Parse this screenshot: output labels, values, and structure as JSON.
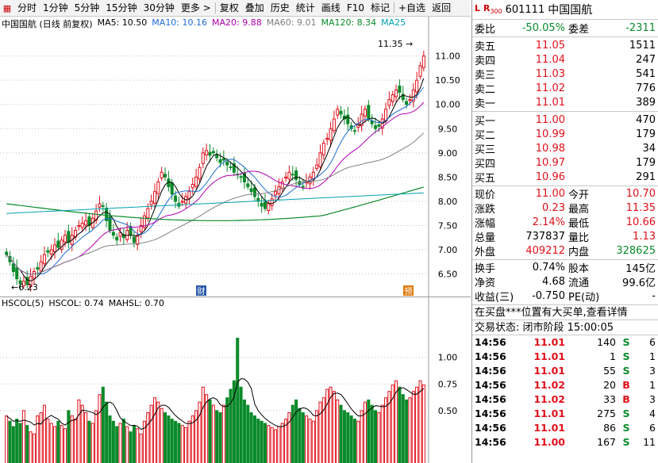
{
  "toolbar": {
    "items": [
      "分时",
      "1分钟",
      "5分钟",
      "15分钟",
      "30分钟",
      "更多 >",
      "复权",
      "叠加",
      "历史",
      "统计",
      "画线",
      "F10",
      "标记",
      "+自选",
      "返回"
    ]
  },
  "kline": {
    "header": {
      "title": "中国国航 (日线 前复权)",
      "ma5": "MA5: 10.50",
      "ma10": "MA10: 10.16",
      "ma20": "MA20: 9.88",
      "ma60": "MA60: 9.01",
      "ma120": "MA120: 8.34",
      "ma250": "MA25"
    },
    "high_label": "11.35",
    "low_label": "6.23",
    "marker_cai": "财",
    "marker_yu": "预",
    "colors": {
      "up": "#e0101a",
      "down": "#0a8a2a"
    }
  },
  "volume": {
    "header": {
      "title": "HSCOL(5)",
      "hscol": "HSCOL: 0.74",
      "mahsl": "MAHSL: 0.70"
    }
  },
  "chart_data": [
    {
      "type": "candlestick",
      "title": "中国国航 (日线 前复权)",
      "y_ticks": [
        6.5,
        7.0,
        7.5,
        8.0,
        8.5,
        9.0,
        9.5,
        10.0,
        10.5,
        11.0
      ],
      "ylim": [
        6.1,
        11.55
      ],
      "annotations": {
        "high": 11.35,
        "low": 6.23
      },
      "close": [
        6.9,
        6.75,
        6.55,
        6.4,
        6.3,
        6.35,
        6.28,
        6.45,
        6.55,
        6.6,
        6.75,
        6.9,
        6.95,
        7.0,
        7.1,
        7.05,
        7.2,
        7.3,
        7.15,
        7.3,
        7.4,
        7.5,
        7.55,
        7.6,
        7.5,
        7.65,
        7.8,
        7.95,
        7.9,
        7.6,
        7.4,
        7.3,
        7.2,
        7.35,
        7.25,
        7.4,
        7.3,
        7.15,
        7.3,
        7.5,
        7.7,
        7.85,
        8.0,
        8.2,
        8.4,
        8.6,
        8.5,
        8.3,
        8.15,
        8.0,
        7.9,
        8.0,
        8.1,
        8.2,
        8.35,
        8.5,
        8.7,
        9.0,
        9.05,
        8.95,
        9.0,
        8.9,
        8.8,
        8.85,
        8.75,
        8.7,
        8.6,
        8.55,
        8.5,
        8.4,
        8.3,
        8.2,
        8.1,
        8.0,
        7.9,
        7.85,
        7.95,
        8.05,
        8.2,
        8.3,
        8.4,
        8.5,
        8.6,
        8.55,
        8.45,
        8.35,
        8.3,
        8.4,
        8.5,
        8.6,
        8.75,
        9.0,
        9.2,
        9.3,
        9.5,
        9.7,
        9.9,
        9.8,
        9.7,
        9.6,
        9.5,
        9.45,
        9.6,
        9.8,
        9.9,
        9.7,
        9.6,
        9.5,
        9.55,
        9.7,
        9.9,
        10.1,
        10.2,
        10.3,
        10.25,
        10.1,
        10.0,
        10.1,
        10.3,
        10.5,
        10.8,
        11.0
      ],
      "ma_lines": [
        "MA5",
        "MA10",
        "MA20",
        "MA60",
        "MA120",
        "MA250"
      ]
    },
    {
      "type": "bar",
      "title": "HSCOL(5)",
      "y_ticks": [
        0.5,
        0.75,
        1.0
      ],
      "ylim": [
        0,
        1.4
      ],
      "series": [
        {
          "name": "HSCOL",
          "values": [
            0.45,
            0.4,
            0.35,
            0.42,
            0.38,
            0.5,
            0.36,
            0.3,
            0.28,
            0.45,
            0.48,
            0.55,
            0.42,
            0.38,
            0.35,
            0.4,
            0.36,
            0.33,
            0.5,
            0.45,
            0.42,
            0.6,
            0.55,
            0.48,
            0.4,
            0.38,
            0.5,
            0.65,
            0.72,
            0.58,
            0.45,
            0.4,
            0.35,
            0.38,
            0.42,
            0.35,
            0.3,
            0.36,
            0.33,
            0.28,
            0.4,
            0.48,
            0.55,
            0.62,
            0.58,
            0.52,
            0.48,
            0.45,
            0.42,
            0.4,
            0.38,
            0.36,
            0.34,
            0.4,
            0.45,
            0.5,
            0.58,
            0.72,
            0.65,
            0.6,
            0.55,
            0.5,
            0.48,
            0.55,
            0.62,
            0.7,
            0.78,
            1.18,
            0.72,
            0.6,
            0.55,
            0.48,
            0.45,
            0.42,
            0.4,
            0.38,
            0.36,
            0.34,
            0.32,
            0.35,
            0.38,
            0.42,
            0.48,
            0.55,
            0.6,
            0.52,
            0.48,
            0.45,
            0.42,
            0.4,
            0.5,
            0.58,
            0.62,
            0.7,
            0.72,
            0.68,
            0.6,
            0.55,
            0.5,
            0.48,
            0.45,
            0.42,
            0.4,
            0.5,
            0.58,
            0.6,
            0.55,
            0.5,
            0.48,
            0.55,
            0.62,
            0.68,
            0.74,
            0.78,
            0.72,
            0.65,
            0.6,
            0.62,
            0.68,
            0.72,
            0.78,
            0.74
          ]
        },
        {
          "name": "MAHSL",
          "values": []
        }
      ]
    }
  ],
  "quote": {
    "lr_label": "L R",
    "sub_label": "300",
    "code": "601111",
    "name": "中国国航",
    "weibi_label": "委比",
    "weibi": "-50.05%",
    "weicha_label": "委差",
    "weicha": "-2311",
    "asks": [
      {
        "label": "卖五",
        "price": "11.05",
        "vol": "1511"
      },
      {
        "label": "卖四",
        "price": "11.04",
        "vol": "247"
      },
      {
        "label": "卖三",
        "price": "11.03",
        "vol": "541"
      },
      {
        "label": "卖二",
        "price": "11.02",
        "vol": "776"
      },
      {
        "label": "卖一",
        "price": "11.01",
        "vol": "389"
      }
    ],
    "bids": [
      {
        "label": "买一",
        "price": "11.00",
        "vol": "470"
      },
      {
        "label": "买二",
        "price": "10.99",
        "vol": "179"
      },
      {
        "label": "买三",
        "price": "10.98",
        "vol": "34"
      },
      {
        "label": "买四",
        "price": "10.97",
        "vol": "179"
      },
      {
        "label": "买五",
        "price": "10.96",
        "vol": "291"
      }
    ],
    "stats1": [
      {
        "l1": "现价",
        "v1": "11.00",
        "c1": "red",
        "l2": "今开",
        "v2": "10.70",
        "c2": "red"
      },
      {
        "l1": "涨跌",
        "v1": "0.23",
        "c1": "red",
        "l2": "最高",
        "v2": "11.35",
        "c2": "red"
      },
      {
        "l1": "涨幅",
        "v1": "2.14%",
        "c1": "red",
        "l2": "最低",
        "v2": "10.66",
        "c2": "red"
      },
      {
        "l1": "总量",
        "v1": "737837",
        "c1": "blk",
        "l2": "量比",
        "v2": "1.13",
        "c2": "red"
      },
      {
        "l1": "外盘",
        "v1": "409212",
        "c1": "red",
        "l2": "内盘",
        "v2": "328625",
        "c2": "green"
      }
    ],
    "stats2": [
      {
        "l1": "换手",
        "v1": "0.74%",
        "l2": "股本",
        "v2": "145亿"
      },
      {
        "l1": "净资",
        "v1": "4.68",
        "l2": "流通",
        "v2": "99.6亿"
      },
      {
        "l1": "收益(三)",
        "v1": "-0.750",
        "l2": "PE(动)",
        "v2": "-"
      }
    ],
    "notice": "在买盘***位置有大买单,查看详情",
    "status": "交易状态: 闭市阶段 15:00:05",
    "ticks": [
      {
        "time": "14:56",
        "price": "11.01",
        "vol": "140",
        "bs": "S",
        "bsc": "green",
        "n": "6"
      },
      {
        "time": "14:56",
        "price": "11.01",
        "vol": "1",
        "bs": "S",
        "bsc": "green",
        "n": "1"
      },
      {
        "time": "14:56",
        "price": "11.01",
        "vol": "55",
        "bs": "S",
        "bsc": "green",
        "n": "3"
      },
      {
        "time": "14:56",
        "price": "11.02",
        "vol": "20",
        "bs": "B",
        "bsc": "red",
        "n": "1"
      },
      {
        "time": "14:56",
        "price": "11.02",
        "vol": "33",
        "bs": "B",
        "bsc": "red",
        "n": "3"
      },
      {
        "time": "14:56",
        "price": "11.01",
        "vol": "275",
        "bs": "S",
        "bsc": "green",
        "n": "4"
      },
      {
        "time": "14:56",
        "price": "11.01",
        "vol": "86",
        "bs": "S",
        "bsc": "green",
        "n": "6"
      },
      {
        "time": "14:56",
        "price": "11.00",
        "vol": "167",
        "bs": "S",
        "bsc": "green",
        "n": "11"
      }
    ]
  }
}
